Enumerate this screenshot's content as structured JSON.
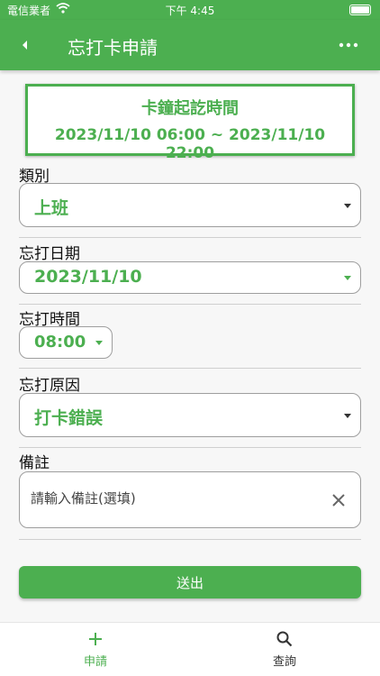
{
  "status_bar": {
    "carrier": "電信業者",
    "time": "下午 4:45"
  },
  "app_bar": {
    "title": "忘打卡申請",
    "back_icon": "back-arrow-icon",
    "more_icon": "more-horizontal-icon"
  },
  "range": {
    "title": "卡鐘起訖時間",
    "value": "2023/11/10 06:00 ~ 2023/11/10 22:00"
  },
  "form": {
    "category": {
      "label": "類別",
      "value": "上班"
    },
    "date": {
      "label": "忘打日期",
      "value": "2023/11/10"
    },
    "time": {
      "label": "忘打時間",
      "value": "08:00"
    },
    "reason": {
      "label": "忘打原因",
      "value": "打卡錯誤"
    },
    "note": {
      "label": "備註",
      "placeholder": "請輸入備註(選填)",
      "value": ""
    }
  },
  "submit_label": "送出",
  "bottom_nav": [
    {
      "label": "申請",
      "icon": "plus-icon",
      "active": true
    },
    {
      "label": "查詢",
      "icon": "search-icon",
      "active": false
    }
  ],
  "colors": {
    "primary": "#4caf50",
    "inactive": "#333333"
  }
}
